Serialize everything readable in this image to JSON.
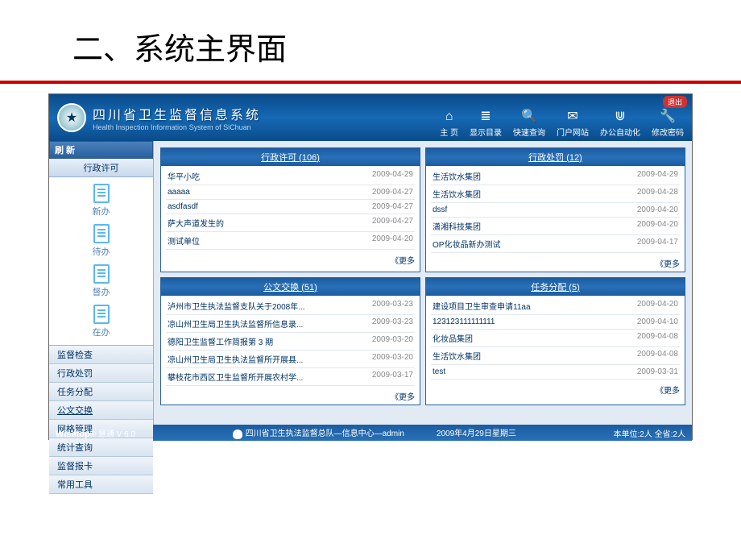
{
  "slide": {
    "title": "二、系统主界面"
  },
  "header": {
    "title": "四川省卫生监督信息系统",
    "subtitle": "Health Inspection Information System of SiChuan",
    "logout": "退出",
    "buttons": [
      {
        "icon": "⌂",
        "label": "主 页"
      },
      {
        "icon": "≣",
        "label": "显示目录"
      },
      {
        "icon": "🔍",
        "label": "快速查询"
      },
      {
        "icon": "✉",
        "label": "门户网站"
      },
      {
        "icon": "⋓",
        "label": "办公自动化"
      },
      {
        "icon": "🔧",
        "label": "修改密码"
      }
    ]
  },
  "sidebar": {
    "refresh": "刷 新",
    "section_title": "行政许可",
    "items": [
      {
        "label": "新办"
      },
      {
        "label": "待办"
      },
      {
        "label": "督办"
      },
      {
        "label": "在办"
      }
    ],
    "menu": [
      "监督检查",
      "行政处罚",
      "任务分配",
      "公文交换",
      "网格管理",
      "统计查询",
      "监督报卡",
      "常用工具"
    ]
  },
  "panels": [
    {
      "title": "行政许可",
      "count": "106",
      "more": "《更多",
      "items": [
        {
          "name": "华平小吃",
          "date": "2009-04-29"
        },
        {
          "name": "aaaaa",
          "date": "2009-04-27"
        },
        {
          "name": "asdfasdf",
          "date": "2009-04-27"
        },
        {
          "name": "萨大声道发生的",
          "date": "2009-04-27"
        },
        {
          "name": "测试单位",
          "date": "2009-04-20"
        }
      ]
    },
    {
      "title": "行政处罚",
      "count": "12",
      "more": "《更多",
      "items": [
        {
          "name": "生活饮水集团",
          "date": "2009-04-29"
        },
        {
          "name": "生活饮水集团",
          "date": "2009-04-28"
        },
        {
          "name": "dssf",
          "date": "2009-04-20"
        },
        {
          "name": "潇湘科技集团",
          "date": "2009-04-20"
        },
        {
          "name": "OP化妆品新办测试",
          "date": "2009-04-17"
        }
      ]
    },
    {
      "title": "公文交换",
      "count": "51",
      "more": "《更多",
      "items": [
        {
          "name": "泸州市卫生执法监督支队关于2008年...",
          "date": "2009-03-23"
        },
        {
          "name": "凉山州卫生局卫生执法监督所信息录...",
          "date": "2009-03-23"
        },
        {
          "name": "德阳卫生监督工作简报第 3 期",
          "date": "2009-03-20"
        },
        {
          "name": "凉山州卫生局卫生执法监督所开展县...",
          "date": "2009-03-20"
        },
        {
          "name": "攀枝花市西区卫生监督所开展农村学...",
          "date": "2009-03-17"
        }
      ]
    },
    {
      "title": "任务分配",
      "count": "5",
      "more": "《更多",
      "items": [
        {
          "name": "建设项目卫生审查申请11aa",
          "date": "2009-04-20"
        },
        {
          "name": "123123111111111",
          "date": "2009-04-10"
        },
        {
          "name": "化妆品集团",
          "date": "2009-04-08"
        },
        {
          "name": "生活饮水集团",
          "date": "2009-04-08"
        },
        {
          "name": "test",
          "date": "2009-03-31"
        }
      ]
    }
  ],
  "footer": {
    "brand_a": "Wisetop",
    "brand_b": "慧通",
    "version": "V 6.0",
    "org": "四川省卫生执法监督总队—信息中心—admin",
    "datetime": "2009年4月29日星期三",
    "stats": "本单位:2人  全省:2人"
  }
}
